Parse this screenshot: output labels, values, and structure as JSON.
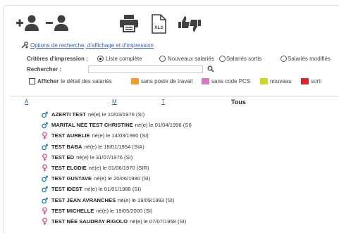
{
  "toolbar": {
    "add_user_icon": "user-plus-icon",
    "remove_user_icon": "user-minus-icon",
    "print_icon": "printer-icon",
    "xls_icon": "xls-file-icon",
    "xls_text": "XLS",
    "thumbs_icon": "thumbs-up-down-icon"
  },
  "options_link": "Options de recherche, d'affichage et d'impression",
  "criteria": {
    "label": "Critères d'impression :",
    "options": [
      {
        "label": "Liste complète",
        "selected": true
      },
      {
        "label": "Nouveaux salariés",
        "selected": false
      },
      {
        "label": "Salariés sortis",
        "selected": false
      },
      {
        "label": "Salariés modifiés",
        "selected": false
      }
    ]
  },
  "search": {
    "label": "Rechercher :",
    "value": "",
    "icon": "search-icon"
  },
  "display": {
    "checkbox_bold": "Afficher",
    "checkbox_rest": "le détail des salariés",
    "legend": [
      {
        "label": "sans poste de travail",
        "color": "#f39c33"
      },
      {
        "label": "sans code PCS",
        "color": "#d67bbf"
      },
      {
        "label": "nouveau",
        "color": "#cfd62a"
      },
      {
        "label": "sorti",
        "color": "#d72828"
      }
    ]
  },
  "alphabet": [
    "A",
    "M",
    "T"
  ],
  "filter_title": "Tous",
  "colors": {
    "male": "#1f7fa4",
    "female": "#c9508f",
    "link": "#3a5fa8"
  },
  "employees": [
    {
      "name": "AZERTI TEST",
      "detail": "né(e) le 10/03/1976 (SI)",
      "sex": "male"
    },
    {
      "name": "MARITAL NÉE TEST CHRISTINE",
      "detail": "né(e) le 01/04/1996 (SI)",
      "sex": "male"
    },
    {
      "name": "TEST AURELIE",
      "detail": "né(e) le 14/03/1980 (SI)",
      "sex": "female"
    },
    {
      "name": "TEST BABA",
      "detail": "né(e) le 18/01/1954 (SIA)",
      "sex": "male"
    },
    {
      "name": "TEST ED",
      "detail": "né(e) le 31/07/1976 (SI)",
      "sex": "female"
    },
    {
      "name": "TEST ELODIE",
      "detail": "né(e) le 01/06/1970 (SIR)",
      "sex": "female"
    },
    {
      "name": "TEST GUSTAVE",
      "detail": "né(e) le 20/06/1980 (SI)",
      "sex": "male"
    },
    {
      "name": "TEST IDEST",
      "detail": "né(e) le 01/01/1988 (SI)",
      "sex": "male"
    },
    {
      "name": "TEST JEAN AVRANCHES",
      "detail": "né(e) le 19/09/1993 (SI)",
      "sex": "male"
    },
    {
      "name": "TEST MICHELLE",
      "detail": "né(e) le 19/05/2000 (SI)",
      "sex": "female"
    },
    {
      "name": "TEST NÉE SAUDRAY RIGOLO",
      "detail": "né(e) le 07/07/1958 (SI)",
      "sex": "female"
    }
  ]
}
